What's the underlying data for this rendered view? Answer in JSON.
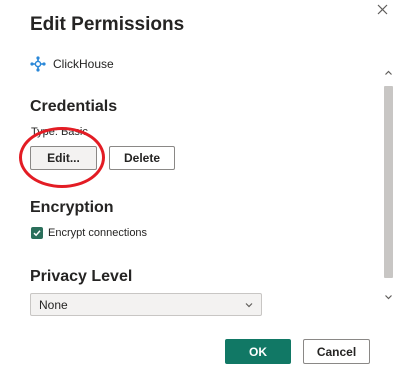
{
  "dialog": {
    "title": "Edit Permissions",
    "source_name": "ClickHouse"
  },
  "credentials": {
    "heading": "Credentials",
    "type_text": "Type: Basic",
    "edit_label": "Edit...",
    "delete_label": "Delete"
  },
  "encryption": {
    "heading": "Encryption",
    "checkbox_label": "Encrypt connections",
    "checked": true
  },
  "privacy": {
    "heading": "Privacy Level",
    "selected": "None"
  },
  "footer": {
    "ok_label": "OK",
    "cancel_label": "Cancel"
  },
  "icons": {
    "close": "close-icon",
    "source": "connector-icon",
    "checkbox": "checkmark-icon",
    "dropdown": "chevron-down-icon"
  },
  "colors": {
    "primary": "#117865",
    "checkbox": "#2b6f5b",
    "highlight": "#e31c24"
  }
}
